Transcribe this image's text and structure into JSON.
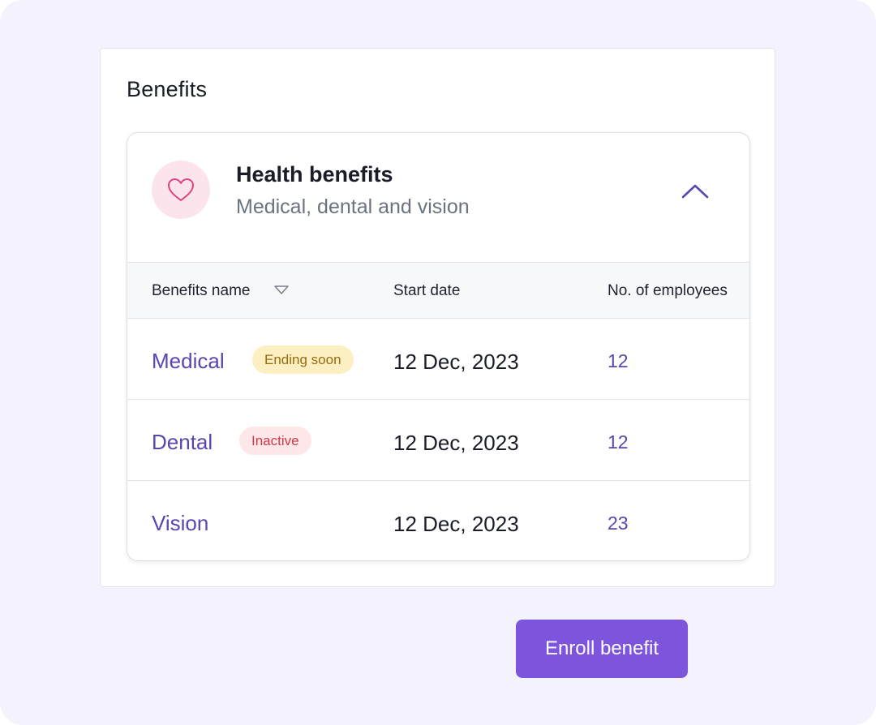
{
  "panel": {
    "title": "Benefits"
  },
  "card": {
    "title": "Health benefits",
    "subtitle": "Medical, dental and vision",
    "icon": "heart-icon",
    "collapse_icon": "chevron-up-icon"
  },
  "table": {
    "headers": {
      "name": "Benefits name",
      "start_date": "Start date",
      "employees": "No. of employees"
    },
    "sort_icon": "sort-down-icon",
    "rows": [
      {
        "name": "Medical",
        "badge": "Ending soon",
        "badge_type": "warning",
        "start_date": "12 Dec, 2023",
        "employees": "12"
      },
      {
        "name": "Dental",
        "badge": "Inactive",
        "badge_type": "danger",
        "start_date": "12 Dec, 2023",
        "employees": "12"
      },
      {
        "name": "Vision",
        "badge": "",
        "badge_type": "",
        "start_date": "12 Dec, 2023",
        "employees": "23"
      }
    ]
  },
  "actions": {
    "enroll_label": "Enroll benefit"
  },
  "colors": {
    "page_background": "#f4f2fd",
    "accent": "#7d54dc",
    "link": "#5b45b0",
    "warning_bg": "#fcf0c2",
    "warning_text": "#9a6a10",
    "danger_bg": "#fde7e9",
    "danger_text": "#cf3a45",
    "heart_bg": "#fbe4ec",
    "heart_stroke": "#e0417f"
  }
}
